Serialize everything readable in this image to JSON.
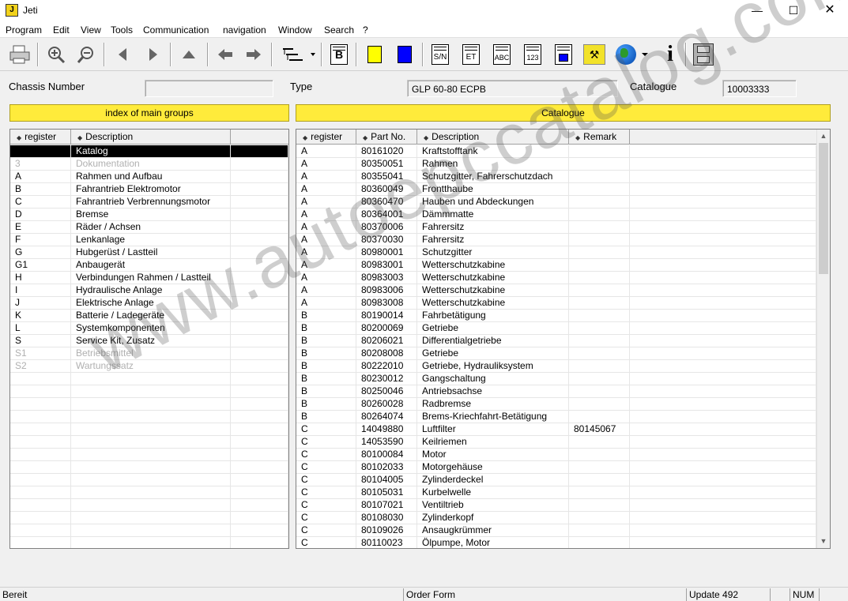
{
  "window": {
    "title": "Jeti"
  },
  "menu": [
    "Program",
    "Edit",
    "View",
    "Tools",
    "Communication",
    "navigation",
    "Window",
    "Search",
    "?"
  ],
  "toolbar": {
    "doc_labels": [
      "S/N",
      "ET",
      "ABC",
      "123"
    ],
    "b_label": "B",
    "info_label": "i"
  },
  "info": {
    "chassis_label": "Chassis Number",
    "chassis_value": "",
    "type_label": "Type",
    "type_value": "GLP 60-80 ECPB",
    "catalogue_label": "Catalogue",
    "catalogue_value": "10003333"
  },
  "left_panel": {
    "title": "index of main groups",
    "columns": [
      "register",
      "Description"
    ],
    "rows": [
      {
        "register": "",
        "description": "Katalog",
        "selected": true
      },
      {
        "register": "3",
        "description": "Dokumentation",
        "dim": true
      },
      {
        "register": "A",
        "description": "Rahmen und Aufbau"
      },
      {
        "register": "B",
        "description": "Fahrantrieb Elektromotor"
      },
      {
        "register": "C",
        "description": "Fahrantrieb Verbrennungsmotor"
      },
      {
        "register": "D",
        "description": "Bremse"
      },
      {
        "register": "E",
        "description": "Räder / Achsen"
      },
      {
        "register": "F",
        "description": "Lenkanlage"
      },
      {
        "register": "G",
        "description": "Hubgerüst / Lastteil"
      },
      {
        "register": "G1",
        "description": "Anbaugerät"
      },
      {
        "register": "H",
        "description": "Verbindungen Rahmen / Lastteil"
      },
      {
        "register": "I",
        "description": "Hydraulische Anlage"
      },
      {
        "register": "J",
        "description": "Elektrische Anlage"
      },
      {
        "register": "K",
        "description": "Batterie / Ladegeräte"
      },
      {
        "register": "L",
        "description": "Systemkomponenten"
      },
      {
        "register": "S",
        "description": "Service Kit, Zusatz"
      },
      {
        "register": "S1",
        "description": "Betriebsmittel",
        "dim": true
      },
      {
        "register": "S2",
        "description": "Wartungssatz",
        "dim": true
      }
    ]
  },
  "right_panel": {
    "title": "Catalogue",
    "columns": [
      "register",
      "Part No.",
      "Description",
      "Remark"
    ],
    "rows": [
      [
        "A",
        "80161020",
        "Kraftstofftank",
        ""
      ],
      [
        "A",
        "80350051",
        "Rahmen",
        ""
      ],
      [
        "A",
        "80355041",
        "Schutzgitter, Fahrerschutzdach",
        ""
      ],
      [
        "A",
        "80360049",
        "Frontthaube",
        ""
      ],
      [
        "A",
        "80360470",
        "Hauben und Abdeckungen",
        ""
      ],
      [
        "A",
        "80364001",
        "Dämmmatte",
        ""
      ],
      [
        "A",
        "80370006",
        "Fahrersitz",
        ""
      ],
      [
        "A",
        "80370030",
        "Fahrersitz",
        ""
      ],
      [
        "A",
        "80980001",
        "Schutzgitter",
        ""
      ],
      [
        "A",
        "80983001",
        "Wetterschutzkabine",
        ""
      ],
      [
        "A",
        "80983003",
        "Wetterschutzkabine",
        ""
      ],
      [
        "A",
        "80983006",
        "Wetterschutzkabine",
        ""
      ],
      [
        "A",
        "80983008",
        "Wetterschutzkabine",
        ""
      ],
      [
        "B",
        "80190014",
        "Fahrbetätigung",
        ""
      ],
      [
        "B",
        "80200069",
        "Getriebe",
        ""
      ],
      [
        "B",
        "80206021",
        "Differentialgetriebe",
        ""
      ],
      [
        "B",
        "80208008",
        "Getriebe",
        ""
      ],
      [
        "B",
        "80222010",
        "Getriebe, Hydrauliksystem",
        ""
      ],
      [
        "B",
        "80230012",
        "Gangschaltung",
        ""
      ],
      [
        "B",
        "80250046",
        "Antriebsachse",
        ""
      ],
      [
        "B",
        "80260028",
        "Radbremse",
        ""
      ],
      [
        "B",
        "80264074",
        "Brems-Kriechfahrt-Betätigung",
        ""
      ],
      [
        "C",
        "14049880",
        "Luftfilter",
        "80145067"
      ],
      [
        "C",
        "14053590",
        "Keilriemen",
        ""
      ],
      [
        "C",
        "80100084",
        "Motor",
        ""
      ],
      [
        "C",
        "80102033",
        "Motorgehäuse",
        ""
      ],
      [
        "C",
        "80104005",
        "Zylinderdeckel",
        ""
      ],
      [
        "C",
        "80105031",
        "Kurbelwelle",
        ""
      ],
      [
        "C",
        "80107021",
        "Ventiltrieb",
        ""
      ],
      [
        "C",
        "80108030",
        "Zylinderkopf",
        ""
      ],
      [
        "C",
        "80109026",
        "Ansaugkrümmer",
        ""
      ],
      [
        "C",
        "80110023",
        "Ölpumpe, Motor",
        ""
      ]
    ]
  },
  "watermark": "www.autoepccatalog.com",
  "status": {
    "left": "Bereit",
    "order": "Order Form",
    "update": "Update 492",
    "num": "NUM"
  }
}
